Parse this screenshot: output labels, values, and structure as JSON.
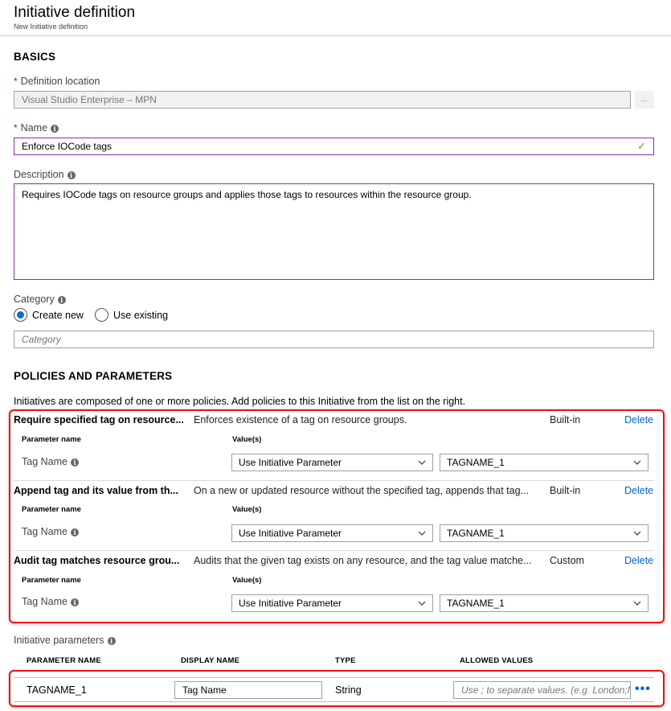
{
  "header": {
    "title": "Initiative definition",
    "subtitle": "New Initiative definition"
  },
  "basics": {
    "heading": "BASICS",
    "definition_location": {
      "label": "Definition location",
      "required_marker": "*",
      "value": "Visual Studio Enterprise – MPN",
      "browse_button": "..."
    },
    "name": {
      "label": "Name",
      "required_marker": "*",
      "value": "Enforce IOCode tags",
      "valid_icon": "check-icon"
    },
    "description": {
      "label": "Description",
      "value": "Requires IOCode tags on resource groups and applies those tags to resources within the resource group."
    },
    "category": {
      "label": "Category",
      "options": [
        {
          "label": "Create new",
          "selected": true
        },
        {
          "label": "Use existing",
          "selected": false
        }
      ],
      "placeholder": "Category"
    }
  },
  "policies": {
    "heading": "POLICIES AND PARAMETERS",
    "intro": "Initiatives are composed of one or more policies. Add policies to this Initiative from the list on the right.",
    "col_param_name": "Parameter name",
    "col_values": "Value(s)",
    "delete_label": "Delete",
    "items": [
      {
        "title": "Require specified tag on resource...",
        "description": "Enforces existence of a tag on resource groups.",
        "type": "Built-in",
        "param_name": "Tag Name",
        "value_mode": "Use Initiative Parameter",
        "value_param": "TAGNAME_1"
      },
      {
        "title": "Append tag and its value from th...",
        "description": "On a new or updated resource without the specified tag, appends that tag...",
        "type": "Built-in",
        "param_name": "Tag Name",
        "value_mode": "Use Initiative Parameter",
        "value_param": "TAGNAME_1"
      },
      {
        "title": "Audit tag matches resource grou...",
        "description": "Audits that the given tag exists on any resource, and the tag value matche...",
        "type": "Custom",
        "param_name": "Tag Name",
        "value_mode": "Use Initiative Parameter",
        "value_param": "TAGNAME_1"
      }
    ]
  },
  "initiative_parameters": {
    "label": "Initiative parameters",
    "columns": [
      "PARAMETER NAME",
      "DISPLAY NAME",
      "TYPE",
      "ALLOWED VALUES"
    ],
    "rows": [
      {
        "parameter_name": "TAGNAME_1",
        "display_name": "Tag Name",
        "type": "String",
        "allowed_values_placeholder": "Use ; to separate values. (e.g. London;N",
        "more_label": "•••"
      }
    ]
  },
  "colors": {
    "accent_purple": "#8a2fa0",
    "link_blue": "#0a63c9",
    "highlight_red": "#ee1111",
    "valid_green": "#5aa50a",
    "required_red": "#ee0000"
  }
}
